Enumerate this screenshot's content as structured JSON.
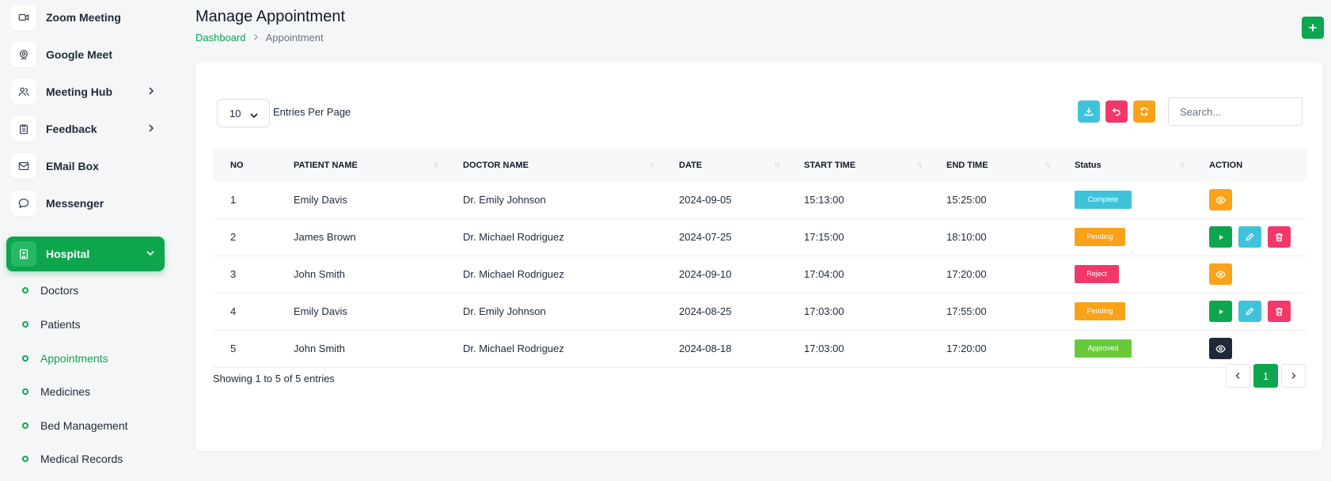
{
  "sidebar": {
    "items": [
      {
        "label": "Zoom Meeting",
        "icon": "video-icon"
      },
      {
        "label": "Google Meet",
        "icon": "webcam-icon"
      },
      {
        "label": "Meeting Hub",
        "icon": "users-icon",
        "has_submenu": true
      },
      {
        "label": "Feedback",
        "icon": "clipboard-icon",
        "has_submenu": true
      },
      {
        "label": "EMail Box",
        "icon": "mail-icon"
      },
      {
        "label": "Messenger",
        "icon": "chat-icon"
      },
      {
        "label": "Hospital",
        "icon": "hospital-icon",
        "active": true,
        "expanded": true
      }
    ],
    "subitems": [
      {
        "label": "Doctors"
      },
      {
        "label": "Patients"
      },
      {
        "label": "Appointments",
        "active": true
      },
      {
        "label": "Medicines"
      },
      {
        "label": "Bed Management"
      },
      {
        "label": "Medical Records"
      }
    ]
  },
  "header": {
    "title": "Manage Appointment",
    "breadcrumb": {
      "home": "Dashboard",
      "current": "Appointment"
    },
    "add_label": "+"
  },
  "toolbar": {
    "entries_value": "10",
    "entries_label": "Entries Per Page",
    "search_placeholder": "Search..."
  },
  "table": {
    "columns": [
      "NO",
      "PATIENT NAME",
      "DOCTOR NAME",
      "DATE",
      "START TIME",
      "END TIME",
      "Status",
      "ACTION"
    ],
    "rows": [
      {
        "no": "1",
        "patient": "Emily Davis",
        "doctor": "Dr. Emily Johnson",
        "date": "2024-09-05",
        "start": "15:13:00",
        "end": "15:25:00",
        "status": "Complete"
      },
      {
        "no": "2",
        "patient": "James Brown",
        "doctor": "Dr. Michael Rodriguez",
        "date": "2024-07-25",
        "start": "17:15:00",
        "end": "18:10:00",
        "status": "Pending"
      },
      {
        "no": "3",
        "patient": "John Smith",
        "doctor": "Dr. Michael Rodriguez",
        "date": "2024-09-10",
        "start": "17:04:00",
        "end": "17:20:00",
        "status": "Reject"
      },
      {
        "no": "4",
        "patient": "Emily Davis",
        "doctor": "Dr. Emily Johnson",
        "date": "2024-08-25",
        "start": "17:03:00",
        "end": "17:55:00",
        "status": "Pending"
      },
      {
        "no": "5",
        "patient": "John Smith",
        "doctor": "Dr. Michael Rodriguez",
        "date": "2024-08-18",
        "start": "17:03:00",
        "end": "17:20:00",
        "status": "Approved"
      }
    ]
  },
  "footer": {
    "showing": "Showing 1 to 5 of 5 entries",
    "current_page": "1"
  },
  "colors": {
    "primary": "#0da64f",
    "complete": "#3ec3db",
    "pending": "#f9a21a",
    "reject": "#f2386b",
    "approved": "#69c93a"
  }
}
